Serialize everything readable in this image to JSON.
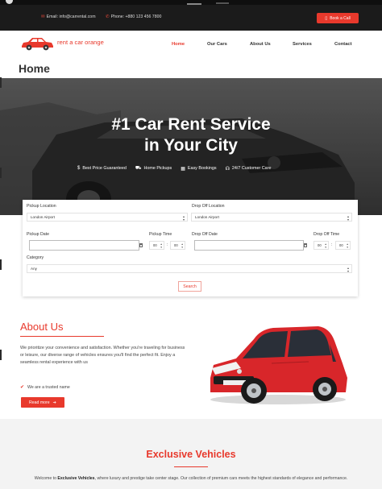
{
  "topbar": {
    "email": "Email: info@carrental.com",
    "phone": "Phone: +880 123 456 7800",
    "book_call": "Book a Call"
  },
  "nav": {
    "logo_text": "rent a car orange",
    "items": [
      "Home",
      "Our Cars",
      "About Us",
      "Services",
      "Contact"
    ],
    "active": "Home"
  },
  "page_title": "Home",
  "hero": {
    "title_line1": "#1 Car Rent Service",
    "title_line2": "in Your City",
    "features": [
      {
        "icon": "dollar-icon",
        "label": "Best Price Guaranteed"
      },
      {
        "icon": "truck-icon",
        "label": "Home Pickups"
      },
      {
        "icon": "calendar-icon",
        "label": "Easy Bookings"
      },
      {
        "icon": "headset-icon",
        "label": "24/7 Customer Care"
      }
    ]
  },
  "search": {
    "pickup_location_label": "Pickup Location",
    "pickup_location_value": "London Airport",
    "dropoff_location_label": "Drop Off Location",
    "dropoff_location_value": "London Airport",
    "pickup_date_label": "Pickup Date",
    "pickup_time_label": "Pickup Time",
    "dropoff_date_label": "Drop Off Date",
    "dropoff_time_label": "Drop Off Time",
    "time_hour": "00",
    "time_min": "00",
    "category_label": "Category",
    "category_value": "Any",
    "search_button": "Search"
  },
  "about": {
    "title": "About Us",
    "text": "We prioritize your convenience and satisfaction. Whether you're traveling for business or leisure, our diverse range of vehicles ensures you'll find the perfect fit. Enjoy a seamless rental experience with us",
    "trusted": "We are a trusted name",
    "read_more": "Read more"
  },
  "exclusive": {
    "title": "Exclusive Vehicles",
    "text_pre": "Welcome to ",
    "text_bold": "Exclusive Vehicles",
    "text_post": ", where luxury and prestige take center stage. Our collection of premium cars meets the highest standards of elegance and performance."
  },
  "colors": {
    "accent": "#e8392c",
    "topbar_bg": "#1b1b1b",
    "section_bg": "#f3f3f3"
  }
}
